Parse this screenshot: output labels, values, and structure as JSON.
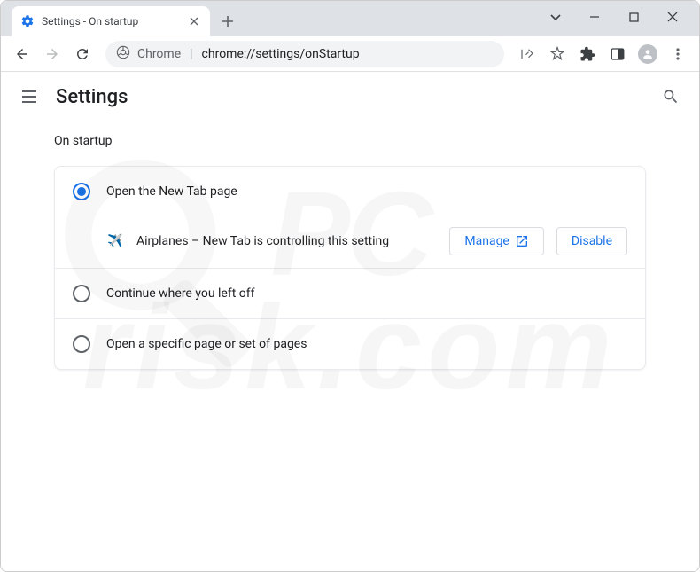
{
  "window": {
    "tab_title": "Settings - On startup"
  },
  "omnibox": {
    "origin": "Chrome",
    "path": "chrome://settings/onStartup"
  },
  "settings": {
    "title": "Settings",
    "section": "On startup",
    "options": [
      {
        "label": "Open the New Tab page",
        "selected": true
      },
      {
        "label": "Continue where you left off",
        "selected": false
      },
      {
        "label": "Open a specific page or set of pages",
        "selected": false
      }
    ],
    "extension": {
      "name": "Airplanes – New Tab is controlling this setting",
      "manage_label": "Manage",
      "disable_label": "Disable"
    }
  },
  "watermark": {
    "line1": "PC",
    "line2": "risk.com"
  }
}
